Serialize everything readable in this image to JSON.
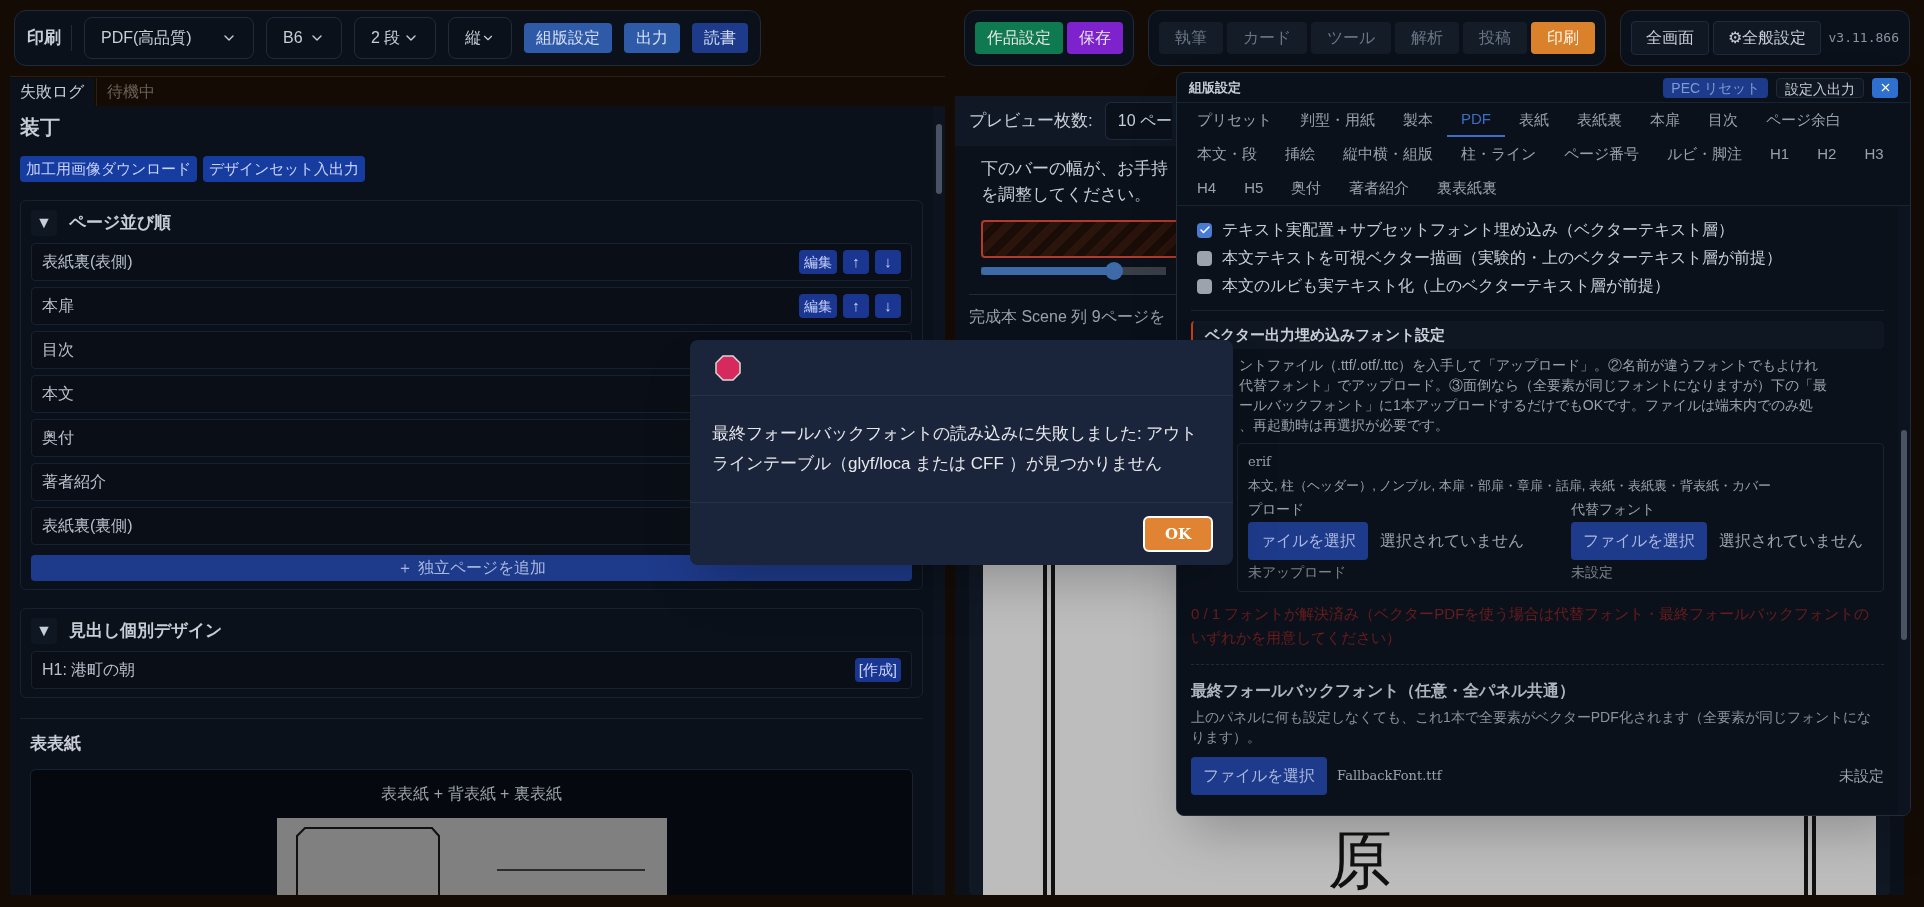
{
  "toolbar": {
    "title": "印刷",
    "selects": [
      {
        "value": "PDF(高品質)"
      },
      {
        "value": "B6"
      },
      {
        "value": "2 段"
      },
      {
        "value": "縦"
      }
    ],
    "buttons": [
      {
        "label": "組版設定",
        "kind": "primary"
      },
      {
        "label": "出力",
        "kind": "primary"
      },
      {
        "label": "読書",
        "kind": "dark"
      }
    ]
  },
  "project_buttons": [
    {
      "label": "作品設定",
      "color": "#0f7a4f"
    },
    {
      "label": "保存",
      "color": "#7e22ce"
    }
  ],
  "mode_tabs": [
    {
      "label": "執筆",
      "selected": false
    },
    {
      "label": "カード",
      "selected": false
    },
    {
      "label": "ツール",
      "selected": false
    },
    {
      "label": "解析",
      "selected": false
    },
    {
      "label": "投稿",
      "selected": false
    },
    {
      "label": "印刷",
      "selected": true
    }
  ],
  "view_buttons": [
    {
      "label": "全画面"
    },
    {
      "label": "⚙全般設定"
    }
  ],
  "version": "v3.11.866",
  "log_tabs": [
    {
      "label": "失敗ログ",
      "selected": true
    },
    {
      "label": "待機中",
      "selected": false
    }
  ],
  "binding": {
    "title": "装丁",
    "buttons": [
      "加工用画像ダウンロード",
      "デザインセット入出力"
    ],
    "page_order": {
      "toggle": "▼",
      "title": "ページ並び順",
      "expanded": true,
      "rows": [
        {
          "label": "表紙裏(表側)",
          "edit": "編集",
          "up": "↑",
          "down": "↓"
        },
        {
          "label": "本扉",
          "edit": "編集",
          "up": "↑",
          "down": "↓"
        },
        {
          "label": "目次"
        },
        {
          "label": "本文"
        },
        {
          "label": "奥付"
        },
        {
          "label": "著者紹介"
        },
        {
          "label": "表紙裏(裏側)"
        }
      ],
      "add_button": "＋ 独立ページを追加"
    },
    "heading_design": {
      "toggle": "▼",
      "title": "見出し個別デザイン",
      "expanded": true,
      "rows": [
        {
          "label": "H1: 港町の朝",
          "action": "[作成]"
        }
      ]
    },
    "front_cover": {
      "title": "表表紙",
      "caption": "表表紙 + 背表紙 + 裏表紙"
    }
  },
  "preview": {
    "count_label": "プレビュー枚数:",
    "count_value": "10 ペー",
    "hint_lines": [
      "下のバーの幅が、お手持",
      "を調整してください。"
    ],
    "slider": {
      "level": 0.72
    },
    "status": "完成本 Scene 列 9ページを",
    "page_text": "原"
  },
  "settings_panel": {
    "title": "組版設定",
    "reset": "PEC リセット",
    "io": "設定入出力",
    "tabs": [
      {
        "label": "プリセット",
        "selected": false
      },
      {
        "label": "判型・用紙",
        "selected": false
      },
      {
        "label": "製本",
        "selected": false
      },
      {
        "label": "PDF",
        "selected": true
      },
      {
        "label": "表紙",
        "selected": false
      },
      {
        "label": "表紙裏",
        "selected": false
      },
      {
        "label": "本扉",
        "selected": false
      },
      {
        "label": "目次",
        "selected": false
      },
      {
        "label": "ページ余白",
        "selected": false
      },
      {
        "label": "本文・段",
        "selected": false
      },
      {
        "label": "挿絵",
        "selected": false
      },
      {
        "label": "縦中横・組版",
        "selected": false
      },
      {
        "label": "柱・ライン",
        "selected": false
      },
      {
        "label": "ページ番号",
        "selected": false
      },
      {
        "label": "ルビ・脚注",
        "selected": false
      },
      {
        "label": "H1",
        "selected": false
      },
      {
        "label": "H2",
        "selected": false
      },
      {
        "label": "H3",
        "selected": false
      },
      {
        "label": "H4",
        "selected": false
      },
      {
        "label": "H5",
        "selected": false
      },
      {
        "label": "奥付",
        "selected": false
      },
      {
        "label": "著者紹介",
        "selected": false
      },
      {
        "label": "裏表紙裏",
        "selected": false
      }
    ],
    "checkboxes": [
      {
        "label": "テキスト実配置＋サブセットフォント埋め込み（ベクターテキスト層）",
        "checked": true
      },
      {
        "label": "本文テキストを可視ベクター描画（実験的・上のベクターテキスト層が前提）",
        "checked": false
      },
      {
        "label": "本文のルビも実テキスト化（上のベクターテキスト層が前提）",
        "checked": false
      }
    ],
    "font_section": {
      "title": "ベクター出力埋め込みフォント設定",
      "lines": [
        "ントファイル（.ttf/.otf/.ttc）を入手して「アップロード」。②名前が違うフォントでもよけれ",
        "代替フォント」でアップロード。③面倒なら（全要素が同じフォントになりますが）下の「最",
        "ールバックフォント」に1本アップロードするだけでもOKです。ファイルは端末内でのみ処",
        "、再起動時は再選択が必要です。"
      ],
      "font_card": {
        "name": "erif",
        "usage": "本文, 柱（ヘッダー）, ノンブル, 本扉・部扉・章扉・話扉, 表紙・表紙裏・背表紙・カバー",
        "slots": [
          {
            "label": "プロード",
            "button": "ァイルを選択",
            "file": "選択されていません",
            "status": "未アップロード"
          },
          {
            "label": "代替フォント",
            "button": "ファイルを選択",
            "file": "選択されていません",
            "status": "未設定"
          }
        ]
      },
      "warning": "0 / 1 フォントが解決済み（ベクターPDFを使う場合は代替フォント・最終フォールバックフォントのいずれかを用意してください）"
    },
    "fallback": {
      "title": "最終フォールバックフォント（任意・全パネル共通）",
      "description": "上のパネルに何も設定しなくても、これ1本で全要素がベクターPDF化されます（全要素が同じフォントになります）。",
      "button": "ファイルを選択",
      "file": "FallbackFont.ttf",
      "status": "未設定"
    }
  },
  "dialog": {
    "message": "最終フォールバックフォントの読み込みに失敗しました: アウトラインテーブル（glyf/loca または CFF ）が見つかりません",
    "ok": "OK"
  }
}
